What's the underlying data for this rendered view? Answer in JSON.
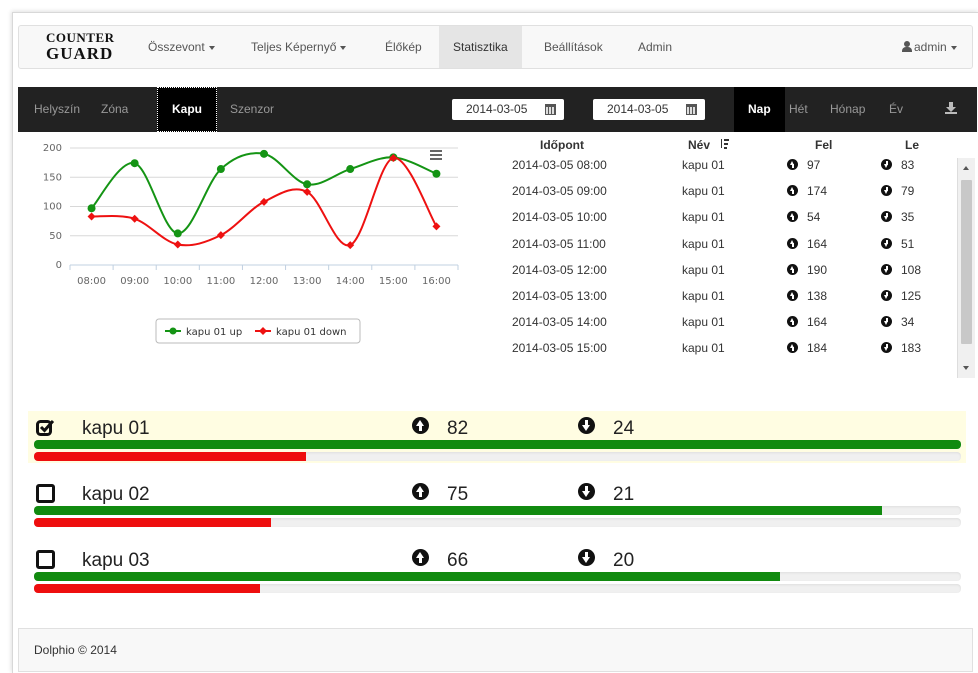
{
  "brand": {
    "line1": "COUNTER",
    "line2": "GUARD"
  },
  "nav": {
    "items": [
      {
        "label": "Összevont",
        "dropdown": true
      },
      {
        "label": "Teljes Képernyő",
        "dropdown": true
      },
      {
        "label": "Élőkép",
        "dropdown": false
      },
      {
        "label": "Statisztika",
        "dropdown": false,
        "active": true
      },
      {
        "label": "Beállítások",
        "dropdown": false
      },
      {
        "label": "Admin",
        "dropdown": false
      }
    ],
    "user": "admin"
  },
  "toolbar": {
    "tabs": [
      "Helyszín",
      "Zóna",
      "Kapu",
      "Szenzor"
    ],
    "active_tab": "Kapu",
    "date_from": "2014-03-05",
    "date_to": "2014-03-05",
    "periods": [
      "Nap",
      "Hét",
      "Hónap",
      "Év"
    ],
    "active_period": "Nap"
  },
  "chart_data": {
    "type": "line",
    "categories": [
      "08:00",
      "09:00",
      "10:00",
      "11:00",
      "12:00",
      "13:00",
      "14:00",
      "15:00",
      "16:00"
    ],
    "series": [
      {
        "name": "kapu 01 up",
        "color": "#149414",
        "values": [
          97,
          174,
          54,
          164,
          190,
          138,
          164,
          184,
          156
        ]
      },
      {
        "name": "kapu 01 down",
        "color": "#ee1111",
        "values": [
          83,
          79,
          35,
          51,
          108,
          125,
          34,
          183,
          66
        ]
      }
    ],
    "ylim": [
      0,
      200
    ],
    "yticks": [
      0,
      50,
      100,
      150,
      200
    ],
    "grid": true,
    "legend": "bottom",
    "title": "",
    "xlabel": "",
    "ylabel": ""
  },
  "table": {
    "headers": {
      "time": "Időpont",
      "name": "Név",
      "up": "Fel",
      "down": "Le"
    },
    "rows": [
      {
        "time": "2014-03-05 08:00",
        "name": "kapu 01",
        "up": "97",
        "down": "83"
      },
      {
        "time": "2014-03-05 09:00",
        "name": "kapu 01",
        "up": "174",
        "down": "79"
      },
      {
        "time": "2014-03-05 10:00",
        "name": "kapu 01",
        "up": "54",
        "down": "35"
      },
      {
        "time": "2014-03-05 11:00",
        "name": "kapu 01",
        "up": "164",
        "down": "51"
      },
      {
        "time": "2014-03-05 12:00",
        "name": "kapu 01",
        "up": "190",
        "down": "108"
      },
      {
        "time": "2014-03-05 13:00",
        "name": "kapu 01",
        "up": "138",
        "down": "125"
      },
      {
        "time": "2014-03-05 14:00",
        "name": "kapu 01",
        "up": "164",
        "down": "34"
      },
      {
        "time": "2014-03-05 15:00",
        "name": "kapu 01",
        "up": "184",
        "down": "183"
      }
    ]
  },
  "gates": [
    {
      "name": "kapu 01",
      "up": "82",
      "down": "24",
      "checked": true,
      "up_fill": 1.0,
      "down_fill": 0.293
    },
    {
      "name": "kapu 02",
      "up": "75",
      "down": "21",
      "checked": false,
      "up_fill": 0.915,
      "down_fill": 0.256
    },
    {
      "name": "kapu 03",
      "up": "66",
      "down": "20",
      "checked": false,
      "up_fill": 0.805,
      "down_fill": 0.244
    }
  ],
  "footer": {
    "text": "Dolphio © 2014"
  }
}
